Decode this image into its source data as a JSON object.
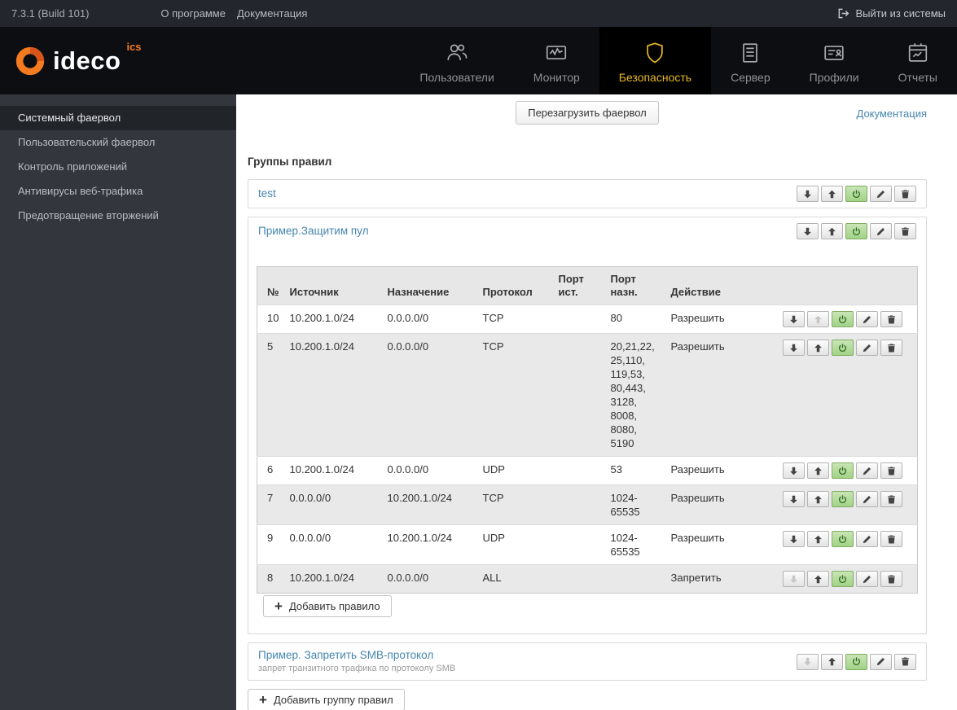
{
  "colors": {
    "link_blue": "#4585ad",
    "nav_active_yellow": "#e5b722",
    "power_green": "#2e6b24",
    "logo_orange": "#f47b20"
  },
  "topbar": {
    "version": "7.3.1 (Build 101)",
    "about": "О программе",
    "documentation": "Документация",
    "logout": "Выйти из системы"
  },
  "logo": {
    "text": "ideco",
    "suffix": "ics"
  },
  "nav": [
    {
      "label": "Пользователи",
      "icon": "users-icon"
    },
    {
      "label": "Монитор",
      "icon": "monitor-icon"
    },
    {
      "label": "Безопасность",
      "icon": "shield-icon"
    },
    {
      "label": "Сервер",
      "icon": "server-icon"
    },
    {
      "label": "Профили",
      "icon": "profiles-icon"
    },
    {
      "label": "Отчеты",
      "icon": "reports-icon"
    }
  ],
  "sidebar": [
    {
      "label": "Системный фаервол"
    },
    {
      "label": "Пользовательский фаервол"
    },
    {
      "label": "Контроль приложений"
    },
    {
      "label": "Антивирусы веб-трафика"
    },
    {
      "label": "Предотвращение вторжений"
    }
  ],
  "content": {
    "reload_button": "Перезагрузить фаервол",
    "documentation_link": "Документация",
    "heading": "Группы правил",
    "groups": [
      {
        "title": "test"
      },
      {
        "title": "Пример.Защитим пул"
      },
      {
        "title": "Пример. Запретить SMB-протокол",
        "subtitle": "запрет транзитного трафика по протоколу SMB"
      }
    ],
    "add_rule": "Добавить правило",
    "add_group": "Добавить группу правил",
    "table": {
      "headers": {
        "num": "№",
        "source": "Источник",
        "destination": "Назначение",
        "protocol": "Протокол",
        "src_port": "Порт ист.",
        "dst_port": "Порт назн.",
        "action": "Действие"
      },
      "rows": [
        {
          "num": "10",
          "source": "10.200.1.0/24",
          "destination": "0.0.0.0/0",
          "protocol": "TCP",
          "src_port": "",
          "dst_port": "80",
          "action": "Разрешить"
        },
        {
          "num": "5",
          "source": "10.200.1.0/24",
          "destination": "0.0.0.0/0",
          "protocol": "TCP",
          "src_port": "",
          "dst_port": "20,21,22, 25,110, 119,53, 80,443, 3128, 8008, 8080, 5190",
          "action": "Разрешить"
        },
        {
          "num": "6",
          "source": "10.200.1.0/24",
          "destination": "0.0.0.0/0",
          "protocol": "UDP",
          "src_port": "",
          "dst_port": "53",
          "action": "Разрешить"
        },
        {
          "num": "7",
          "source": "0.0.0.0/0",
          "destination": "10.200.1.0/24",
          "protocol": "TCP",
          "src_port": "",
          "dst_port": "1024-65535",
          "action": "Разрешить"
        },
        {
          "num": "9",
          "source": "0.0.0.0/0",
          "destination": "10.200.1.0/24",
          "protocol": "UDP",
          "src_port": "",
          "dst_port": "1024-65535",
          "action": "Разрешить"
        },
        {
          "num": "8",
          "source": "10.200.1.0/24",
          "destination": "0.0.0.0/0",
          "protocol": "ALL",
          "src_port": "",
          "dst_port": "",
          "action": "Запретить"
        }
      ]
    }
  }
}
